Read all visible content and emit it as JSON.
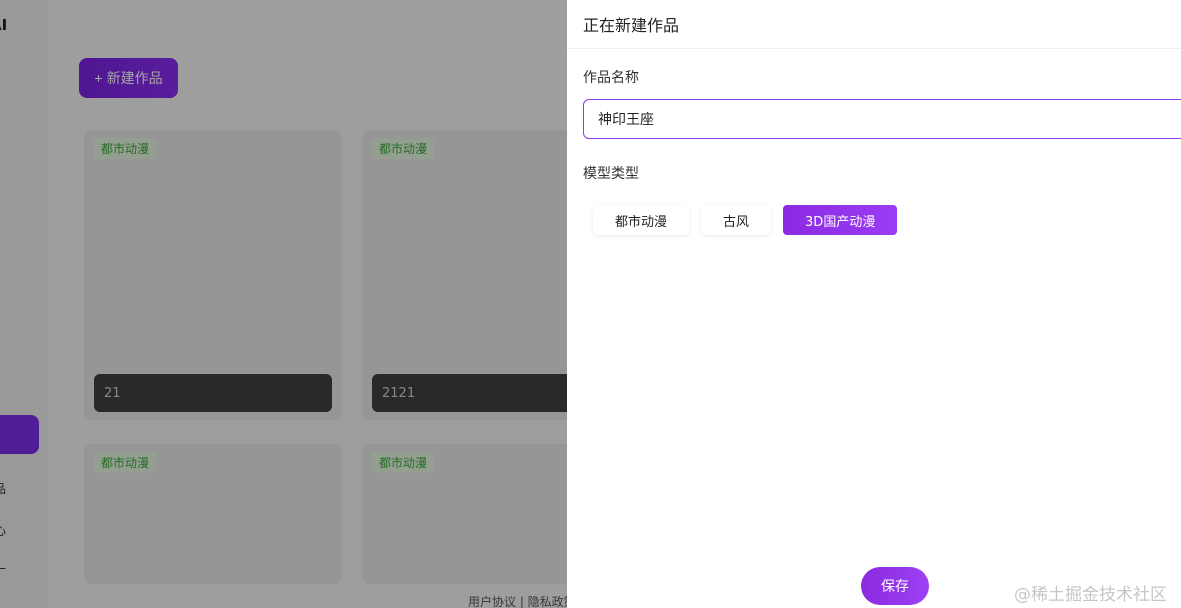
{
  "sidebar": {
    "brand_fragment": "AI",
    "nav_fragments": [
      "品",
      "心",
      "一"
    ]
  },
  "main": {
    "new_button_plus": "+",
    "new_button_label": "新建作品",
    "cards": [
      {
        "tag": "都市动漫",
        "name": "21"
      },
      {
        "tag": "都市动漫",
        "name": "2121"
      },
      {
        "tag": "都市动漫",
        "name": ""
      },
      {
        "tag": "都市动漫",
        "name": ""
      }
    ],
    "footer": "用户协议 | 隐私政策"
  },
  "drawer": {
    "title": "正在新建作品",
    "name_label": "作品名称",
    "name_value": "神印王座",
    "model_label": "模型类型",
    "model_options": [
      {
        "label": "都市动漫",
        "selected": false
      },
      {
        "label": "古风",
        "selected": false
      },
      {
        "label": "3D国产动漫",
        "selected": true
      }
    ],
    "save_label": "保存"
  },
  "watermark": "@稀土掘金技术社区",
  "colors": {
    "accent": "#8a2be2",
    "tag_green": "#3aa63a"
  }
}
